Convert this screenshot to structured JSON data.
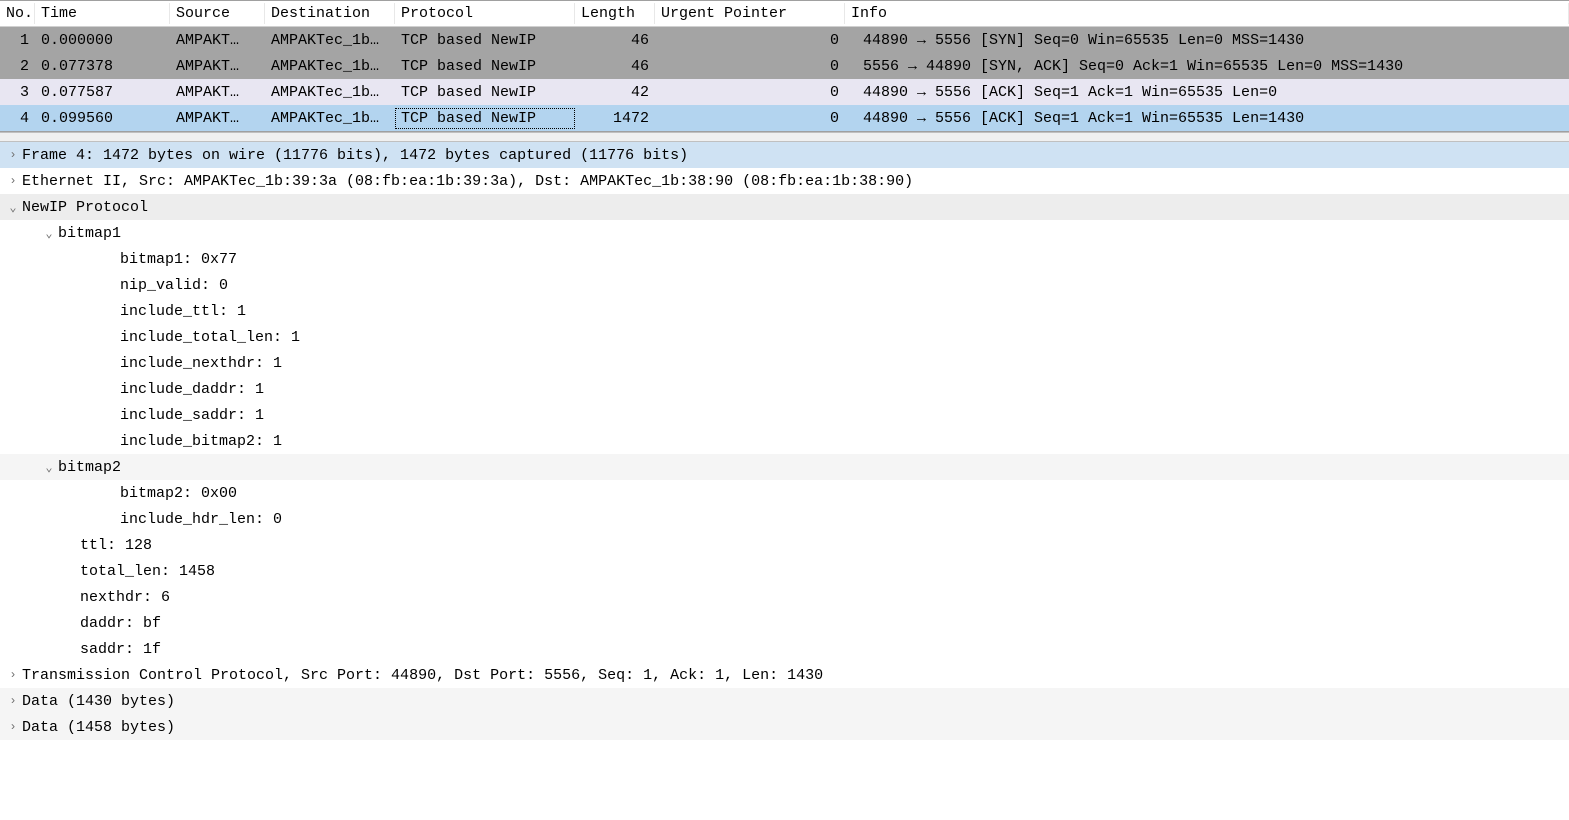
{
  "columns": {
    "no": "No.",
    "time": "Time",
    "source": "Source",
    "destination": "Destination",
    "protocol": "Protocol",
    "length": "Length",
    "urgent": "Urgent Pointer",
    "info": "Info"
  },
  "packets": [
    {
      "no": "1",
      "time": "0.000000",
      "src": "AMPAKT…",
      "dst": "AMPAKTec_1b…",
      "proto": "TCP based NewIP",
      "len": "46",
      "urg": "0",
      "info": "44890 → 5556 [SYN] Seq=0 Win=65535 Len=0 MSS=1430",
      "style": "dark"
    },
    {
      "no": "2",
      "time": "0.077378",
      "src": "AMPAKT…",
      "dst": "AMPAKTec_1b…",
      "proto": "TCP based NewIP",
      "len": "46",
      "urg": "0",
      "info": "5556 → 44890 [SYN, ACK] Seq=0 Ack=1 Win=65535 Len=0 MSS=1430",
      "style": "dark"
    },
    {
      "no": "3",
      "time": "0.077587",
      "src": "AMPAKT…",
      "dst": "AMPAKTec_1b…",
      "proto": "TCP based NewIP",
      "len": "42",
      "urg": "0",
      "info": "44890 → 5556 [ACK] Seq=1 Ack=1 Win=65535 Len=0",
      "style": "light"
    },
    {
      "no": "4",
      "time": "0.099560",
      "src": "AMPAKT…",
      "dst": "AMPAKTec_1b…",
      "proto": "TCP based NewIP",
      "len": "1472",
      "urg": "0",
      "info": "44890 → 5556 [ACK] Seq=1 Ack=1 Win=65535 Len=1430",
      "style": "selected"
    }
  ],
  "details": {
    "frame": "Frame 4: 1472 bytes on wire (11776 bits), 1472 bytes captured (11776 bits)",
    "eth": "Ethernet II, Src: AMPAKTec_1b:39:3a (08:fb:ea:1b:39:3a), Dst: AMPAKTec_1b:38:90 (08:fb:ea:1b:38:90)",
    "newip": "NewIP Protocol",
    "bitmap1_label": "bitmap1",
    "bitmap1_items": [
      "bitmap1: 0x77",
      "nip_valid: 0",
      "include_ttl: 1",
      "include_total_len: 1",
      "include_nexthdr: 1",
      "include_daddr: 1",
      "include_saddr: 1",
      "include_bitmap2: 1"
    ],
    "bitmap2_label": "bitmap2",
    "bitmap2_items": [
      "bitmap2: 0x00",
      "include_hdr_len: 0"
    ],
    "level2_items": [
      "ttl: 128",
      "total_len: 1458",
      "nexthdr: 6",
      "daddr: bf",
      "saddr: 1f"
    ],
    "tcp": "Transmission Control Protocol, Src Port: 44890, Dst Port: 5556, Seq: 1, Ack: 1, Len: 1430",
    "data1": "Data (1430 bytes)",
    "data2": "Data (1458 bytes)"
  },
  "icons": {
    "expand_right": "›",
    "expand_down": "⌄"
  }
}
